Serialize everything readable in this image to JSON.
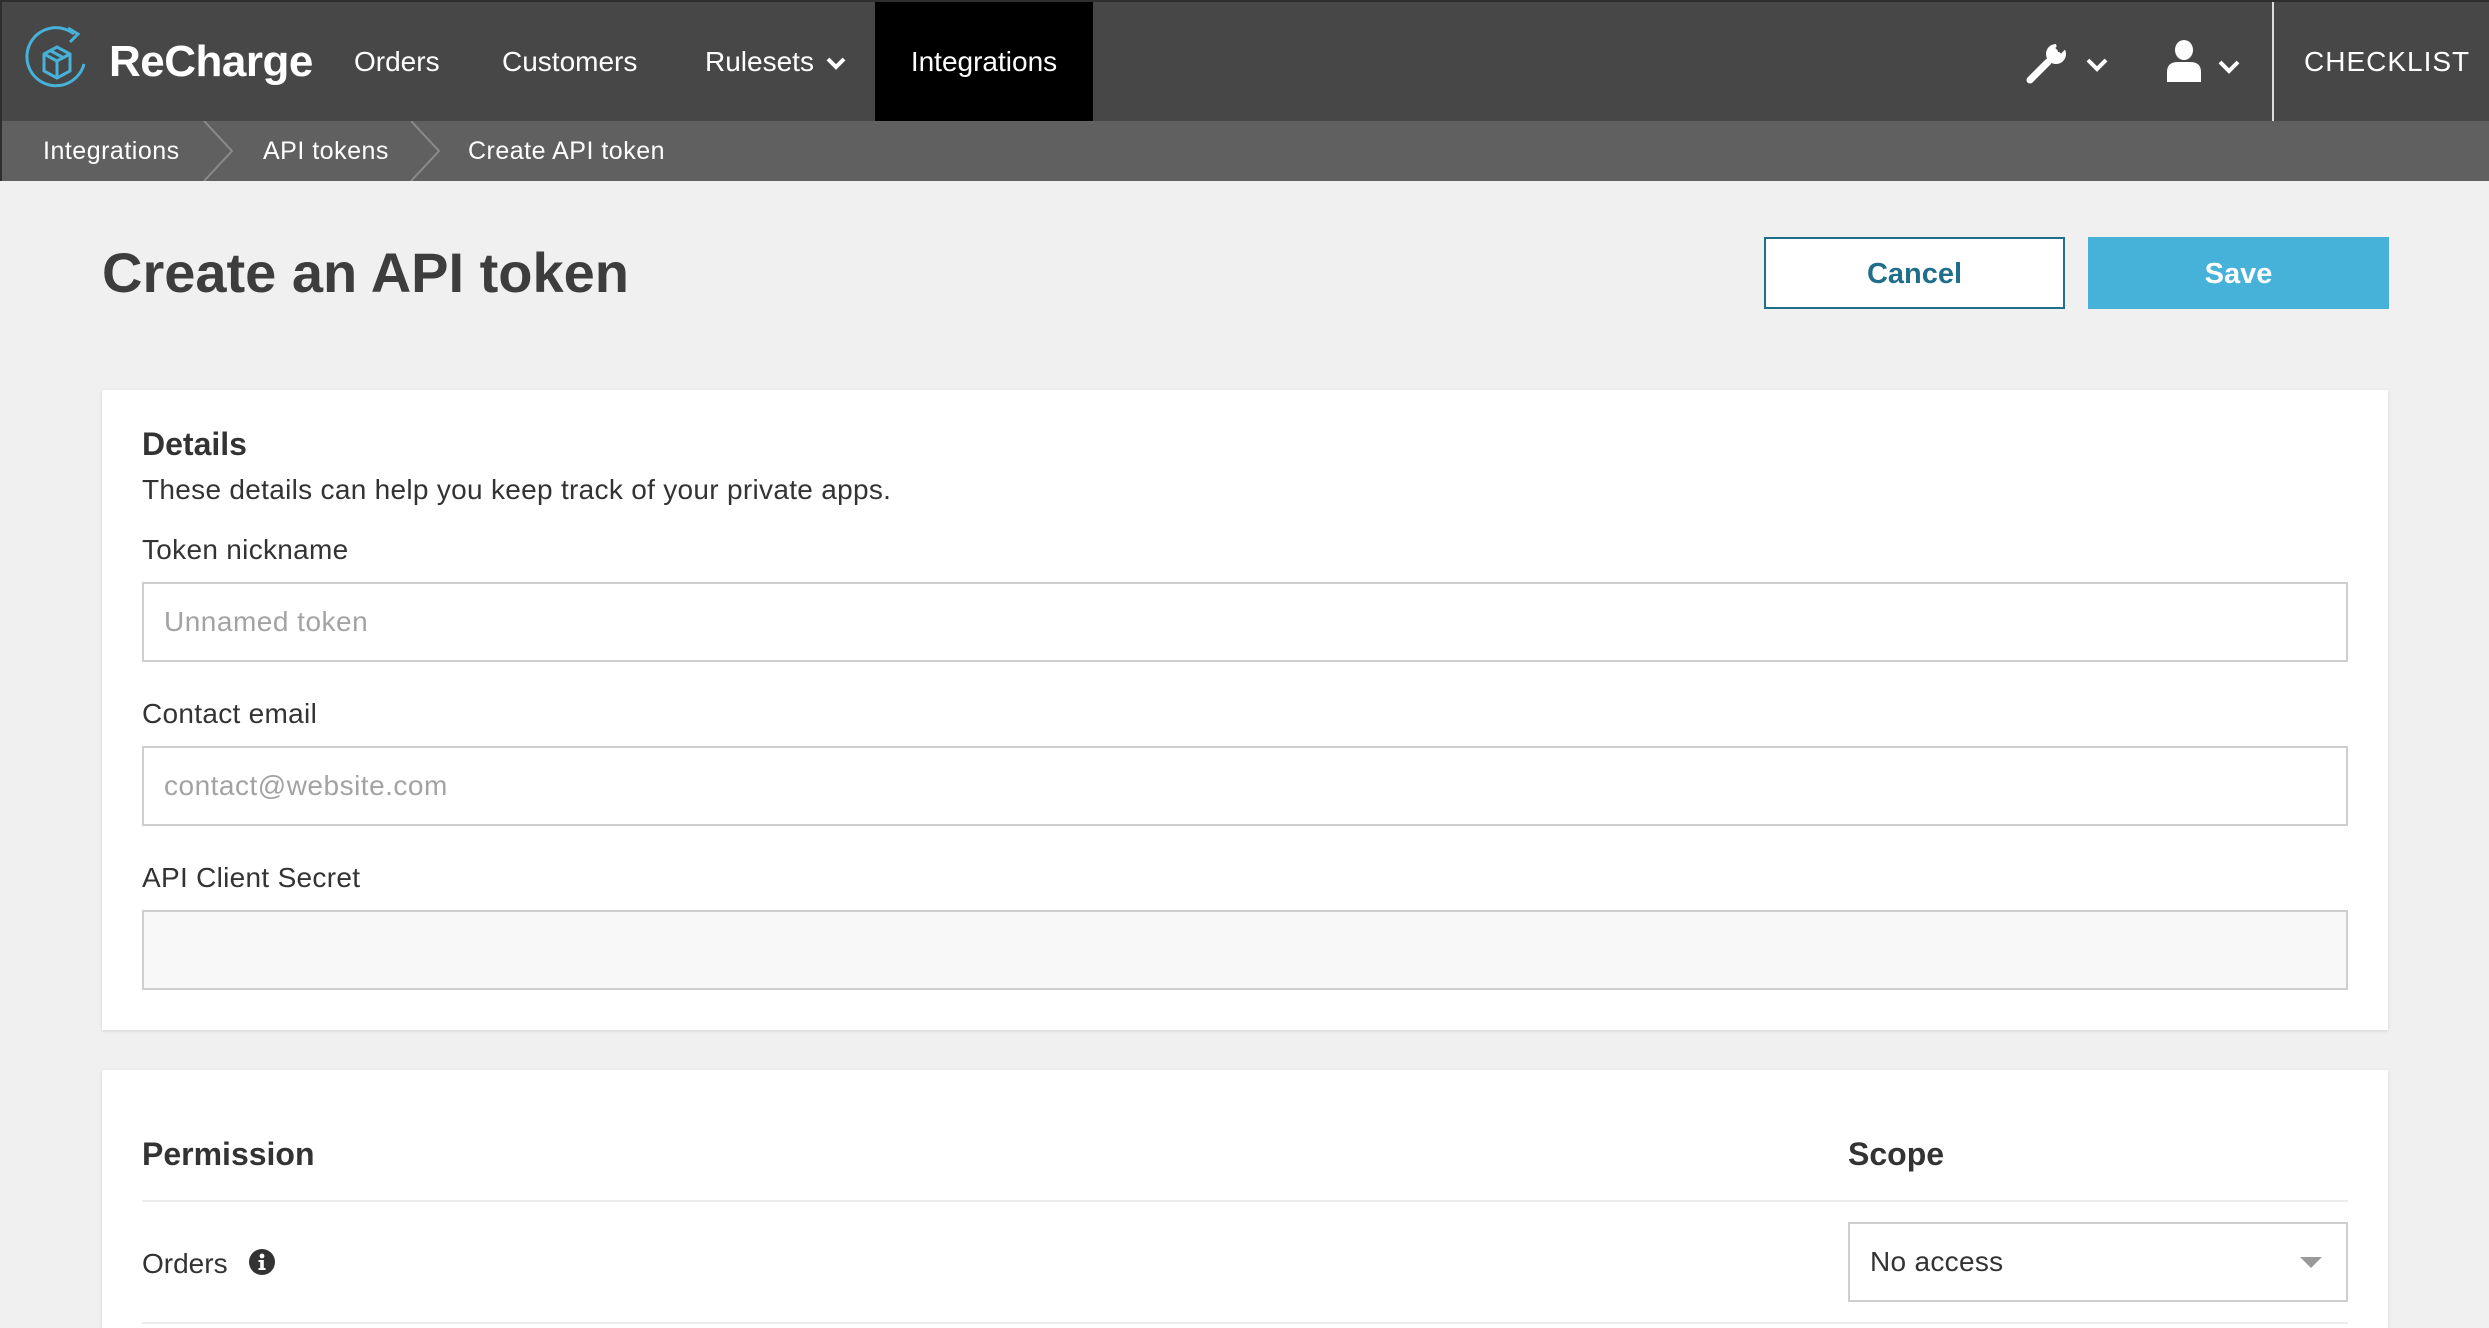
{
  "nav": {
    "brand": "ReCharge",
    "links": {
      "orders": "Orders",
      "customers": "Customers",
      "rulesets": "Rulesets",
      "integrations": "Integrations"
    },
    "checklist": "CHECKLIST",
    "icons": {
      "logo": "recharge-box-logo",
      "tools": "wrench-icon",
      "user": "user-icon",
      "dropdown": "chevron-down-icon"
    },
    "active_color": "#000000",
    "background_color": "#474747"
  },
  "breadcrumb": {
    "items": [
      "Integrations",
      "API tokens",
      "Create API token"
    ]
  },
  "header": {
    "title": "Create an API token",
    "cancel_label": "Cancel",
    "save_label": "Save"
  },
  "details": {
    "title": "Details",
    "description": "These details can help you keep track of your private apps.",
    "nickname_label": "Token nickname",
    "nickname_placeholder": "Unnamed token",
    "email_label": "Contact email",
    "email_placeholder": "contact@website.com",
    "secret_label": "API Client Secret",
    "secret_value": ""
  },
  "permissions": {
    "permission_header": "Permission",
    "scope_header": "Scope",
    "rows": [
      {
        "label": "Orders",
        "info_icon": "info-icon",
        "scope": "No access"
      }
    ]
  },
  "colors": {
    "accent": "#46b1d9",
    "cancel_border": "#1f6f8b"
  }
}
